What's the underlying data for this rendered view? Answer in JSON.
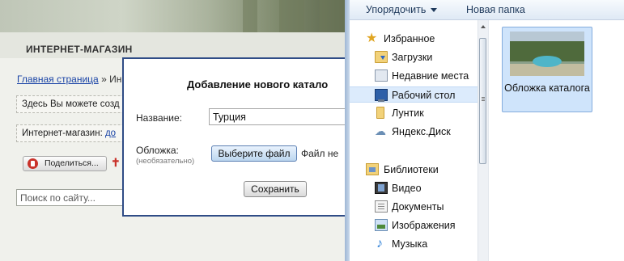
{
  "site": {
    "title": "ИНТЕРНЕТ-МАГАЗИН",
    "breadcrumb_home": "Главная страница",
    "breadcrumb_sep": " » Ин",
    "note_1": "Здесь Вы можете созд",
    "note_2_prefix": "Интернет-магазин: ",
    "note_2_link": "до",
    "share_label": "Поделиться...",
    "search_placeholder": "Поиск по сайту..."
  },
  "dialog": {
    "title": "Добавление нового катало",
    "name_label": "Название:",
    "name_value": "Турция",
    "cover_label": "Обложка:",
    "cover_optional": "(необязательно)",
    "choose_file_label": "Выберите файл",
    "file_status": "Файл не",
    "save_label": "Сохранить"
  },
  "explorer": {
    "toolbar": {
      "organize_label": "Упорядочить",
      "new_folder_label": "Новая папка"
    },
    "nav": {
      "favorites_label": "Избранное",
      "favorites": [
        {
          "label": "Загрузки",
          "icon": "downloads-folder-icon"
        },
        {
          "label": "Недавние места",
          "icon": "recent-places-icon"
        },
        {
          "label": "Рабочий стол",
          "icon": "desktop-icon",
          "selected": true
        },
        {
          "label": "Лунтик",
          "icon": "folder-icon"
        },
        {
          "label": "Яндекс.Диск",
          "icon": "yandex-disk-icon"
        }
      ],
      "libraries_label": "Библиотеки",
      "libraries": [
        {
          "label": "Видео",
          "icon": "video-library-icon"
        },
        {
          "label": "Документы",
          "icon": "documents-library-icon"
        },
        {
          "label": "Изображения",
          "icon": "images-library-icon"
        },
        {
          "label": "Музыка",
          "icon": "music-library-icon"
        }
      ]
    },
    "files": [
      {
        "name": "Обложка каталога",
        "selected": true,
        "icon": "image-thumbnail"
      }
    ]
  }
}
